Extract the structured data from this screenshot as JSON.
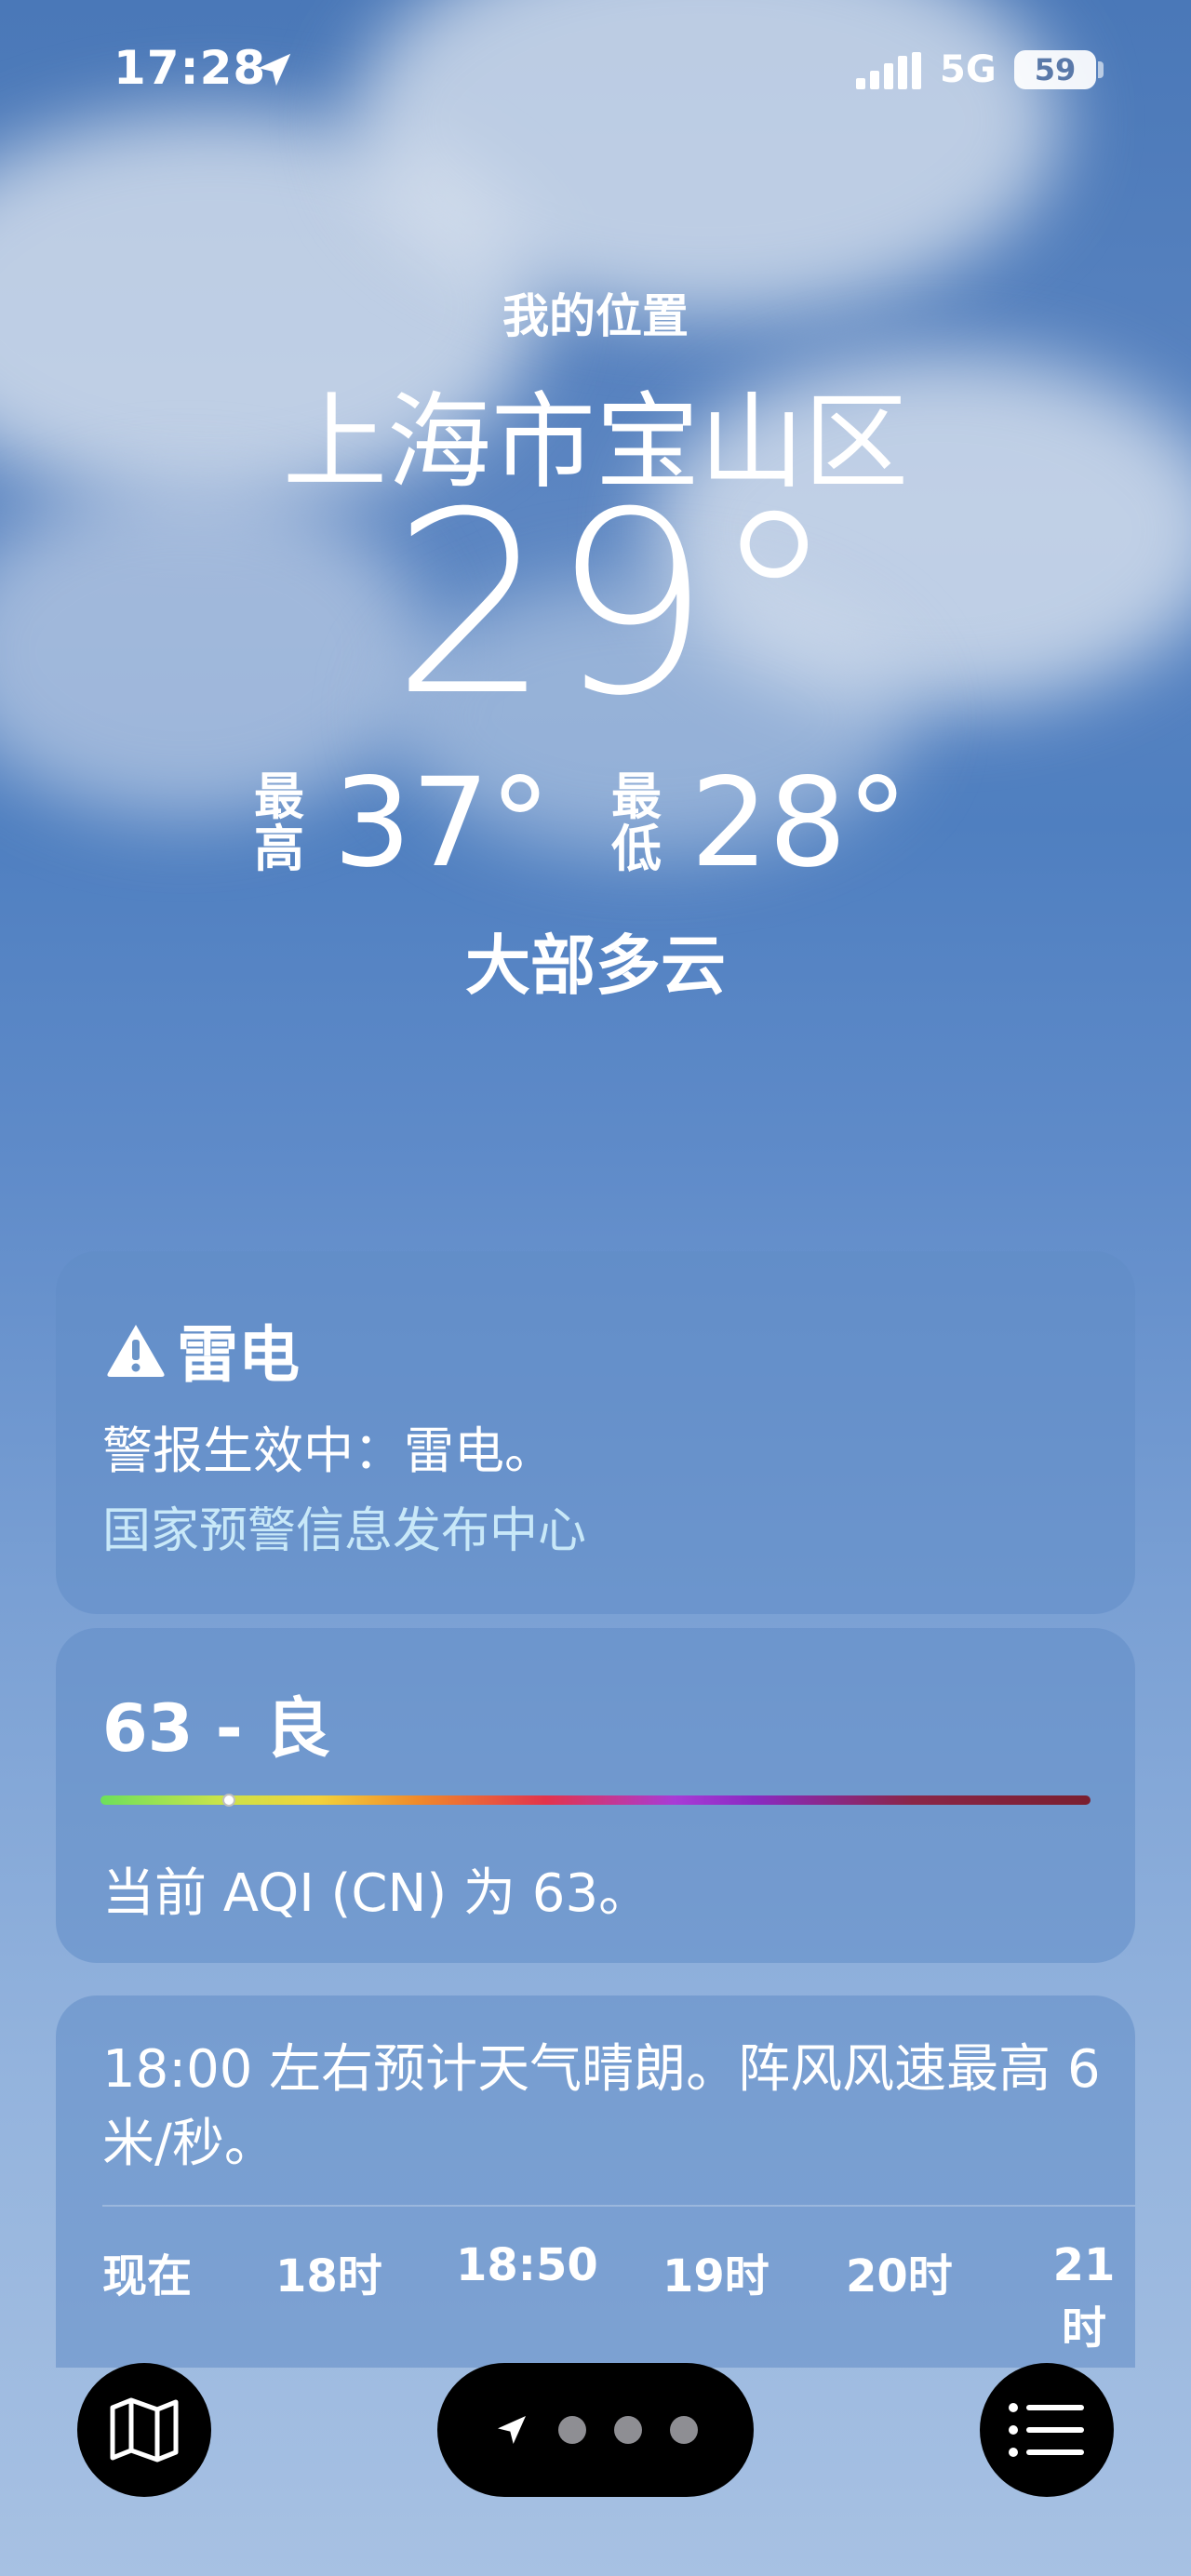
{
  "status_bar": {
    "time": "17:28",
    "network": "5G",
    "battery": "59"
  },
  "header": {
    "location_label": "我的位置",
    "city": "上海市宝山区",
    "temperature": "29°",
    "high_label": "最高",
    "high": "37°",
    "low_label": "最低",
    "low": "28°",
    "condition": "大部多云"
  },
  "alert": {
    "title": "雷电",
    "body": "警报生效中：雷电。",
    "source": "国家预警信息发布中心"
  },
  "aqi": {
    "value_text": "63 - 良",
    "level": 0.13,
    "description": "当前 AQI (CN) 为 63。"
  },
  "forecast": {
    "summary": "18:00 左右预计天气晴朗。阵风风速最高 6 米/秒。",
    "hours": [
      "现在",
      "18时",
      "18:50",
      "19时",
      "20时",
      "21时"
    ]
  },
  "toolbar": {
    "map_icon": "map-icon",
    "location_icon": "location-arrow-icon",
    "list_icon": "list-icon",
    "pages": 3
  },
  "colors": {
    "sky_top": "#4a78b8",
    "sky_bottom": "#a7c1e3",
    "card_bg": "#608cc6",
    "alert_source": "#c8e8f8"
  }
}
